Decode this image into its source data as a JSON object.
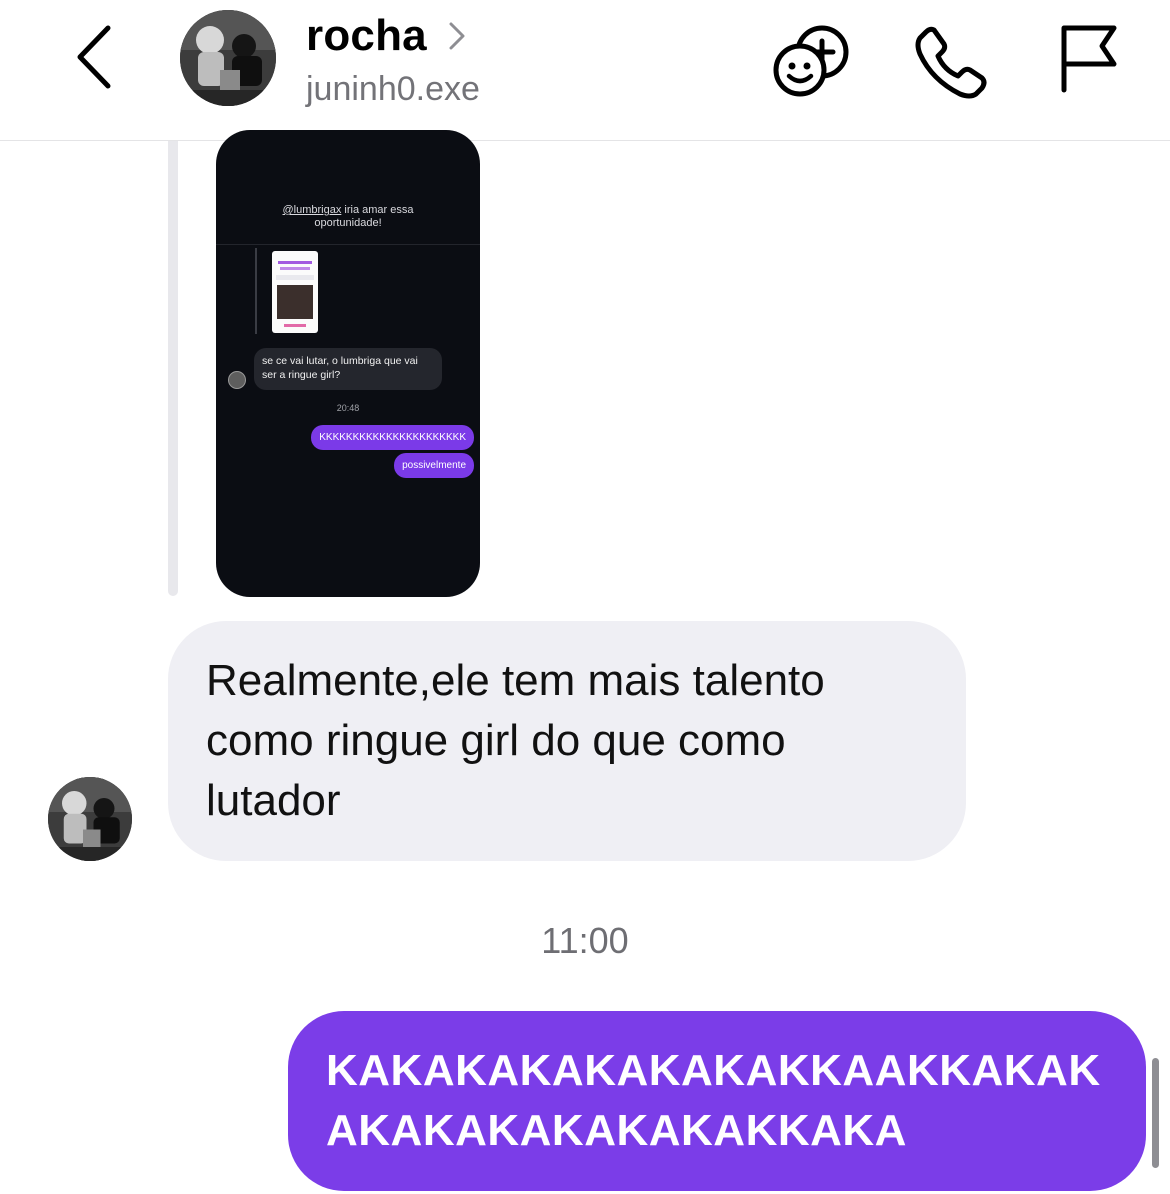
{
  "header": {
    "name": "rocha",
    "handle": "juninh0.exe",
    "icons": [
      "back-chevron-icon",
      "avatar",
      "chevron-right-icon",
      "add-effect-icon",
      "phone-icon",
      "flag-icon"
    ]
  },
  "shared_screenshot": {
    "caption_mention": "@lumbrigax",
    "caption_rest": " iria amar essa oportunidade!",
    "incoming_message": "se ce vai lutar, o lumbriga que vai ser a ringue girl?",
    "time": "20:48",
    "outgoing_messages": [
      "KKKKKKKKKKKKKKKKKKKKKK",
      "possivelmente"
    ]
  },
  "messages": {
    "incoming_text": "Realmente,ele tem mais talento como ringue girl do que como lutador",
    "timestamp": "11:00",
    "outgoing_text": "KAKAKAKAKAKAKAKKAAKKAKAKAKAKAKAKAKAKAKKAKA"
  },
  "colors": {
    "accent_purple": "#7b3de8",
    "incoming_bubble": "#efeff4",
    "muted_text": "#737378"
  }
}
